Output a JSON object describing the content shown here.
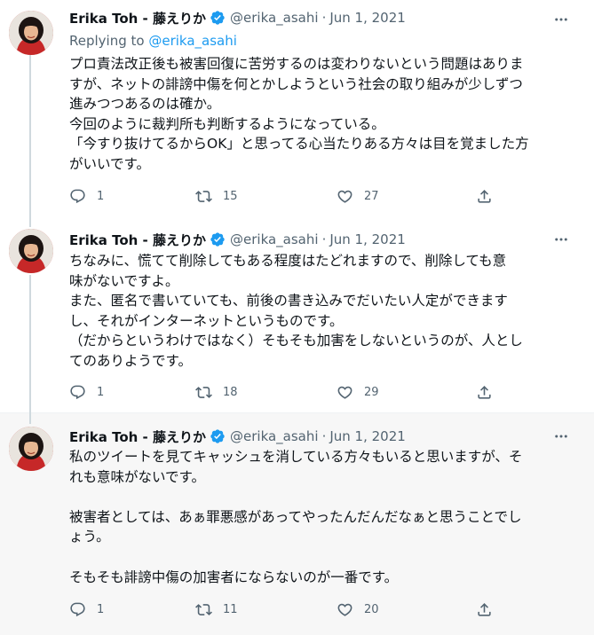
{
  "colors": {
    "accent": "#1d9bf0",
    "text": "#0f1419",
    "secondary": "#536471",
    "thread_line": "#cfd9de",
    "highlight_bg": "#f7f7f7"
  },
  "icons": {
    "verified": "verified-badge-icon",
    "more": "more-horizontal-icon",
    "reply": "reply-icon",
    "retweet": "retweet-icon",
    "like": "heart-icon",
    "share": "share-icon"
  },
  "tweets": [
    {
      "name": "Erika Toh - 藤えりか",
      "handle": "@erika_asahi",
      "sep": "·",
      "date": "Jun 1, 2021",
      "replying_label": "Replying to",
      "replying_handle": "@erika_asahi",
      "lines": [
        "プロ責法改正後も被害回復に苦労するのは変わりないという問題はありま",
        "すが、ネットの誹謗中傷を何とかしようという社会の取り組みが少しずつ",
        "進みつつあるのは確か。",
        "今回のように裁判所も判断するようになっている。",
        "「今すり抜けてるからOK」と思ってる心当たりある方々は目を覚ました方",
        "がいいです。"
      ],
      "replies": "1",
      "retweets": "15",
      "likes": "27"
    },
    {
      "name": "Erika Toh - 藤えりか",
      "handle": "@erika_asahi",
      "sep": "·",
      "date": "Jun 1, 2021",
      "lines": [
        "ちなみに、慌てて削除してもある程度はたどれますので、削除しても意",
        "味がないですよ。",
        "また、匿名で書いていても、前後の書き込みでだいたい人定ができます",
        "し、それがインターネットというものです。",
        "（だからというわけではなく）そもそも加害をしないというのが、人とし",
        "てのありようです。"
      ],
      "replies": "1",
      "retweets": "18",
      "likes": "29"
    },
    {
      "name": "Erika Toh - 藤えりか",
      "handle": "@erika_asahi",
      "sep": "·",
      "date": "Jun 1, 2021",
      "lines": [
        "私のツイートを見てキャッシュを消している方々もいると思いますが、そ",
        "れも意味がないです。",
        "",
        "被害者としては、あぁ罪悪感があってやったんだんだなぁと思うことでし",
        "ょう。",
        "",
        "そもそも誹謗中傷の加害者にならないのが一番です。"
      ],
      "replies": "1",
      "retweets": "11",
      "likes": "20"
    }
  ]
}
